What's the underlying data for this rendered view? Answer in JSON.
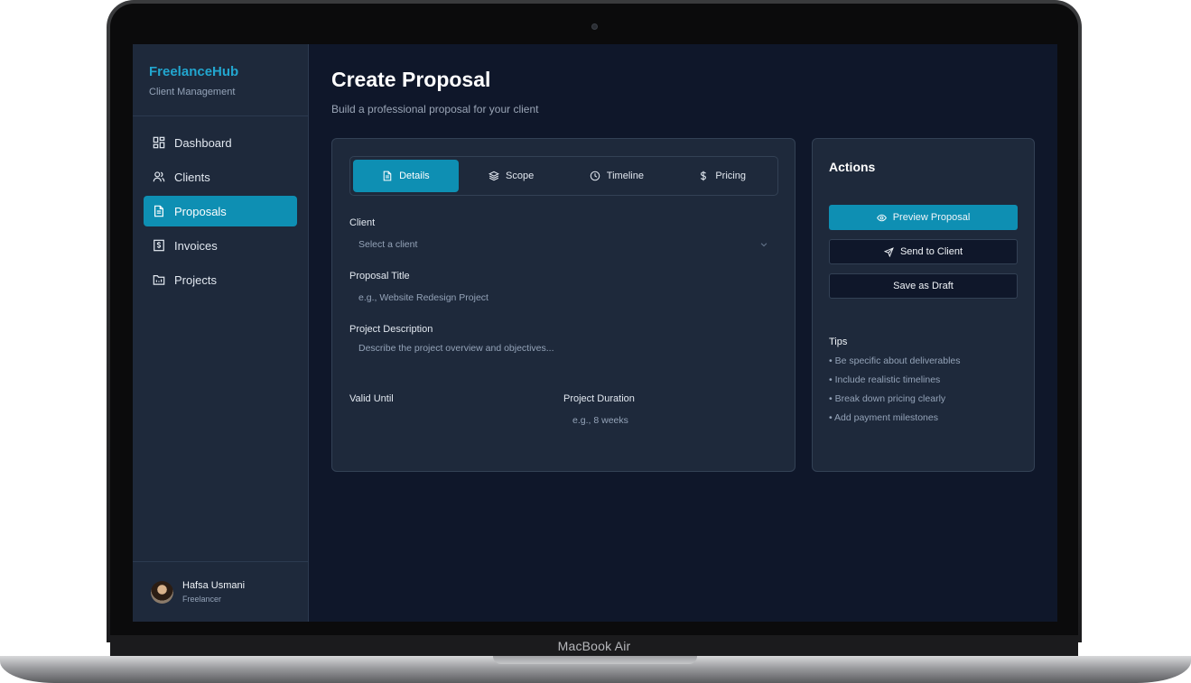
{
  "device_label": "MacBook Air",
  "brand": {
    "name": "FreelanceHub",
    "subtitle": "Client Management"
  },
  "nav": [
    {
      "label": "Dashboard",
      "icon": "grid-icon"
    },
    {
      "label": "Clients",
      "icon": "users-icon"
    },
    {
      "label": "Proposals",
      "icon": "file-icon",
      "active": true
    },
    {
      "label": "Invoices",
      "icon": "dollar-file-icon"
    },
    {
      "label": "Projects",
      "icon": "folder-icon"
    }
  ],
  "user": {
    "name": "Hafsa Usmani",
    "role": "Freelancer"
  },
  "page": {
    "title": "Create Proposal",
    "subtitle": "Build a professional proposal for your client"
  },
  "tabs": [
    {
      "label": "Details",
      "icon": "file-icon",
      "active": true
    },
    {
      "label": "Scope",
      "icon": "layers-icon"
    },
    {
      "label": "Timeline",
      "icon": "clock-icon"
    },
    {
      "label": "Pricing",
      "icon": "dollar-icon"
    }
  ],
  "form": {
    "client": {
      "label": "Client",
      "placeholder": "Select a client"
    },
    "title": {
      "label": "Proposal Title",
      "placeholder": "e.g., Website Redesign Project"
    },
    "description": {
      "label": "Project Description",
      "placeholder": "Describe the project overview and objectives..."
    },
    "valid_until": {
      "label": "Valid Until",
      "placeholder": ""
    },
    "duration": {
      "label": "Project Duration",
      "placeholder": "e.g., 8 weeks"
    }
  },
  "actions": {
    "title": "Actions",
    "preview": "Preview Proposal",
    "send": "Send to Client",
    "draft": "Save as Draft"
  },
  "tips": {
    "title": "Tips",
    "items": [
      "• Be specific about deliverables",
      "• Include realistic timelines",
      "• Break down pricing clearly",
      "• Add payment milestones"
    ]
  },
  "colors": {
    "accent": "#0e8fb3",
    "brand": "#22a6cf",
    "background": "#0f172a",
    "panel": "#1e293b"
  }
}
